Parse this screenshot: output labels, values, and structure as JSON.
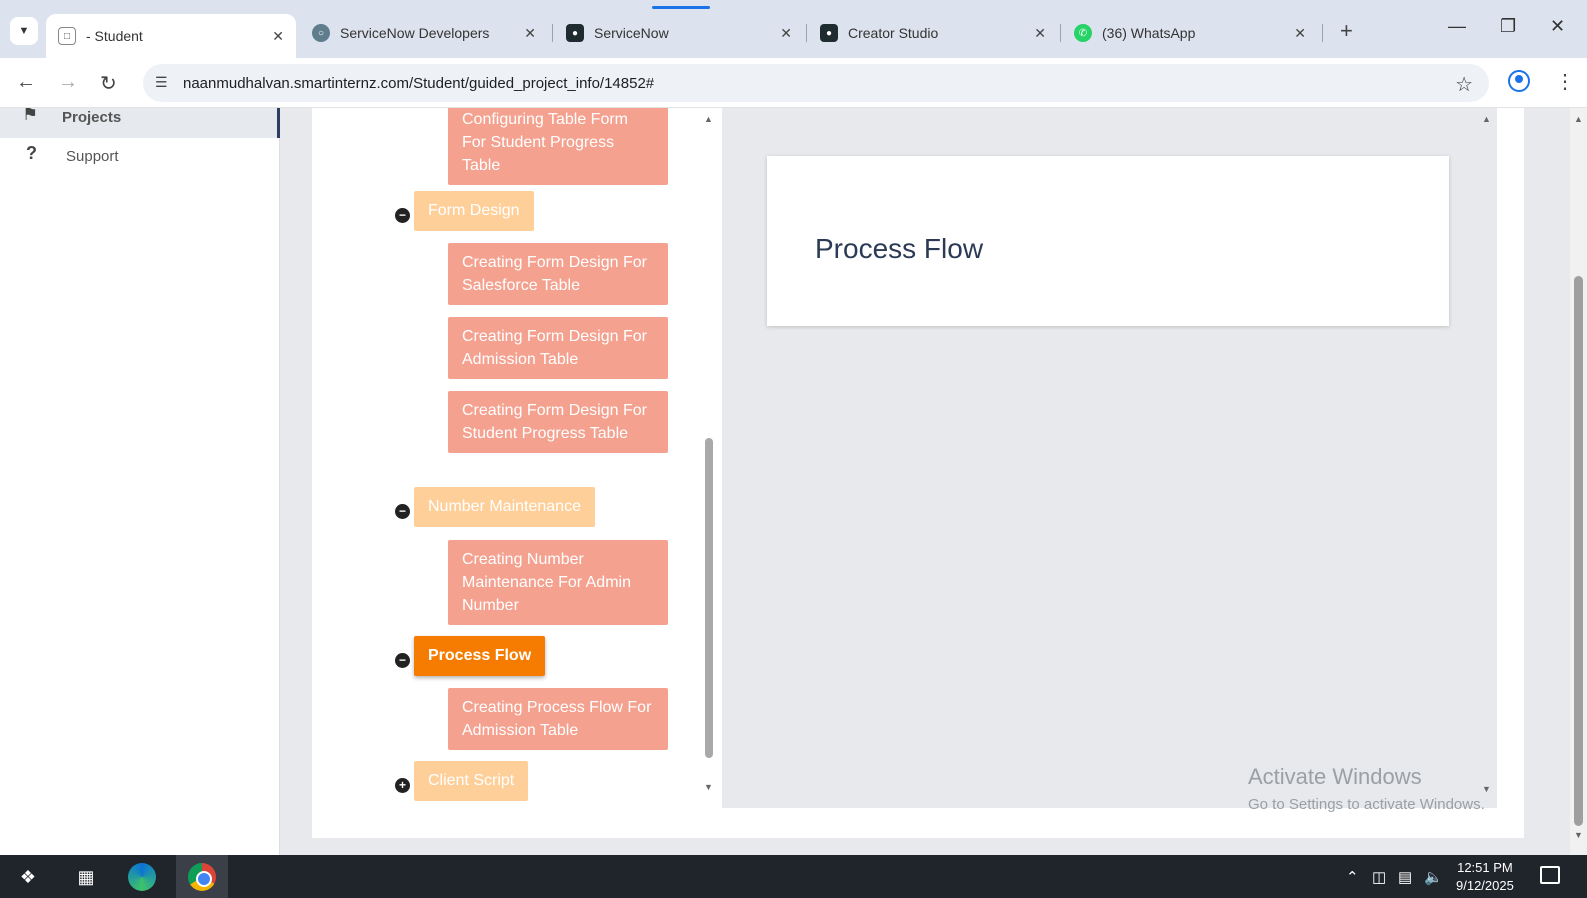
{
  "browser": {
    "tabs": [
      {
        "label": "- Student",
        "active": true
      },
      {
        "label": "ServiceNow Developers",
        "active": false
      },
      {
        "label": "ServiceNow",
        "active": false
      },
      {
        "label": "Creator Studio",
        "active": false
      },
      {
        "label": "(36) WhatsApp",
        "active": false
      }
    ],
    "url": "naanmudhalvan.smartinternz.com/Student/guided_project_info/14852#"
  },
  "sidebar": {
    "items": [
      {
        "label": "Projects",
        "icon": "bookmark-icon"
      },
      {
        "label": "Support",
        "icon": "question-icon"
      }
    ]
  },
  "tree": {
    "top_leaf": "Configuring Table Form For Student Progress Table",
    "form_design": {
      "label": "Form Design",
      "items": [
        "Creating Form Design For Salesforce Table",
        "Creating Form Design For Admission Table",
        "Creating Form Design For Student Progress Table"
      ]
    },
    "number_maintenance": {
      "label": "Number Maintenance",
      "items": [
        "Creating Number Maintenance For Admin Number"
      ]
    },
    "process_flow": {
      "label": "Process Flow",
      "items": [
        "Creating Process Flow For Admission Table"
      ]
    },
    "client_script": {
      "label": "Client Script"
    }
  },
  "content": {
    "title": "Process Flow"
  },
  "watermark": {
    "line1": "Activate Windows",
    "line2": "Go to Settings to activate Windows."
  },
  "taskbar": {
    "time": "12:51 PM",
    "date": "9/12/2025"
  },
  "colors": {
    "node": "#ffcf99",
    "node_active": "#f57c00",
    "leaf": "#f4a18f"
  }
}
